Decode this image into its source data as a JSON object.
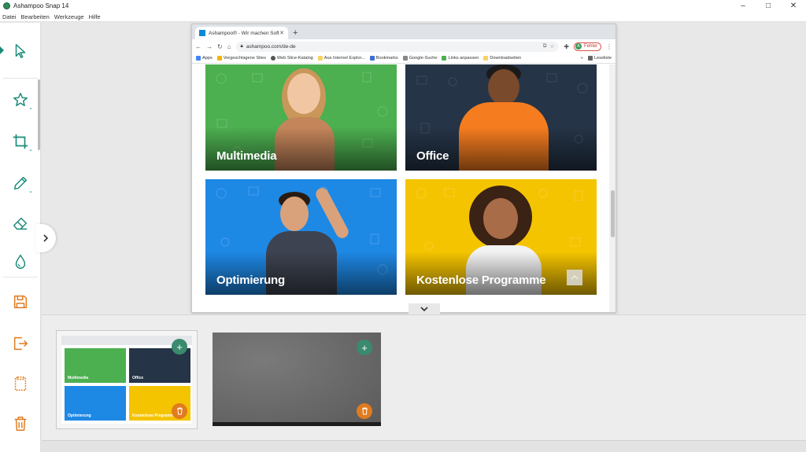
{
  "app": {
    "title": "Ashampoo Snap 14",
    "window_controls": [
      "–",
      "□",
      "✕"
    ]
  },
  "menu": [
    "Datei",
    "Bearbeiten",
    "Werkzeuge",
    "Hilfe"
  ],
  "toolbar": {
    "tools": [
      {
        "name": "select-tool",
        "icon": "cursor-icon"
      },
      {
        "name": "stamp-tool",
        "icon": "star-icon"
      },
      {
        "name": "crop-tool",
        "icon": "crop-icon"
      },
      {
        "name": "pen-tool",
        "icon": "pencil-icon"
      },
      {
        "name": "eraser-tool",
        "icon": "eraser-icon"
      },
      {
        "name": "blur-tool",
        "icon": "drop-icon"
      },
      {
        "name": "save-tool",
        "icon": "save-icon"
      },
      {
        "name": "export-tool",
        "icon": "export-icon"
      },
      {
        "name": "clipboard-tool",
        "icon": "clipboard-icon"
      },
      {
        "name": "delete-tool",
        "icon": "trash-icon"
      }
    ],
    "accent_color": "#1b8a7a",
    "action_color": "#e07b1f"
  },
  "browser": {
    "tab_title": "Ashampoo® - Wir machen Soft",
    "url": "ashampoo.com/de-de",
    "profile_label": "Fehler",
    "profile_initial": "A",
    "bookmarks": [
      "Apps",
      "Vorgeschlagene Sites",
      "Web Slice-Katalog",
      "Aus Internet Explor...",
      "Bookmarks",
      "Google-Suche",
      "Links anpassen",
      "Downloadseiten"
    ],
    "reading_list": "Leseliste",
    "tiles": [
      {
        "label": "Multimedia",
        "color": "#4caf50"
      },
      {
        "label": "Office",
        "color": "#253447"
      },
      {
        "label": "Optimierung",
        "color": "#1e88e5"
      },
      {
        "label": "Kostenlose Programme",
        "color": "#f5c400"
      }
    ]
  },
  "thumbnails": [
    {
      "tiles": [
        "Multimedia",
        "Office",
        "Optimierung",
        "Kostenlose Programme"
      ]
    },
    {
      "kind": "desktop"
    }
  ]
}
